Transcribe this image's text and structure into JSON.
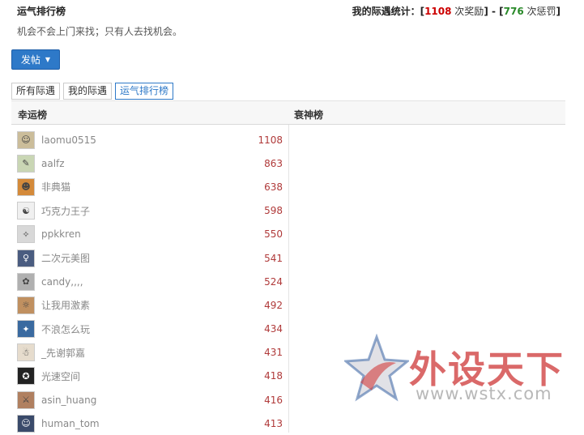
{
  "page": {
    "title": "运气排行榜",
    "motto": "机会不会上门来找；只有人去找机会。"
  },
  "stats": {
    "label": "我的际遇统计：",
    "open_bracket": "[",
    "rewards_count": "1108",
    "rewards_label": " 次奖励",
    "separator": "] - [",
    "penalties_count": "776",
    "penalties_label": " 次惩罚",
    "close_bracket": "]"
  },
  "post_button": {
    "label": "发帖",
    "caret": "▼"
  },
  "tabs": [
    {
      "label": "所有际遇",
      "active": false
    },
    {
      "label": "我的际遇",
      "active": false
    },
    {
      "label": "运气排行榜",
      "active": true
    }
  ],
  "columns": {
    "lucky": "幸运榜",
    "unlucky": "衰神榜"
  },
  "lucky_list": [
    {
      "name": "laomu0515",
      "score": "1108",
      "avatar_icon": "soldier-avatar-icon"
    },
    {
      "name": "aalfz",
      "score": "863",
      "avatar_icon": "sketch-avatar-icon"
    },
    {
      "name": "非典猫",
      "score": "638",
      "avatar_icon": "cat-avatar-icon"
    },
    {
      "name": "巧克力王子",
      "score": "598",
      "avatar_icon": "panda-avatar-icon"
    },
    {
      "name": "ppkkren",
      "score": "550",
      "avatar_icon": "anime-avatar-icon"
    },
    {
      "name": "二次元美图",
      "score": "541",
      "avatar_icon": "anime-girl-avatar-icon"
    },
    {
      "name": "candy,,,,",
      "score": "524",
      "avatar_icon": "candy-avatar-icon"
    },
    {
      "name": "让我用激素",
      "score": "492",
      "avatar_icon": "character-avatar-icon"
    },
    {
      "name": "不浪怎么玩",
      "score": "434",
      "avatar_icon": "blue-character-avatar-icon"
    },
    {
      "name": "_先谢郭嘉",
      "score": "431",
      "avatar_icon": "figure-avatar-icon"
    },
    {
      "name": "光速空间",
      "score": "418",
      "avatar_icon": "space-avatar-icon"
    },
    {
      "name": "asin_huang",
      "score": "416",
      "avatar_icon": "warrior-avatar-icon"
    },
    {
      "name": "human_tom",
      "score": "413",
      "avatar_icon": "person-avatar-icon"
    }
  ],
  "watermark": {
    "text_cn": "外设天下",
    "url": "www.wstx.com"
  },
  "colors": {
    "accent": "#2e79c8",
    "reward": "#cc0000",
    "penalty": "#2a8a2a",
    "score": "#b03a3a"
  }
}
